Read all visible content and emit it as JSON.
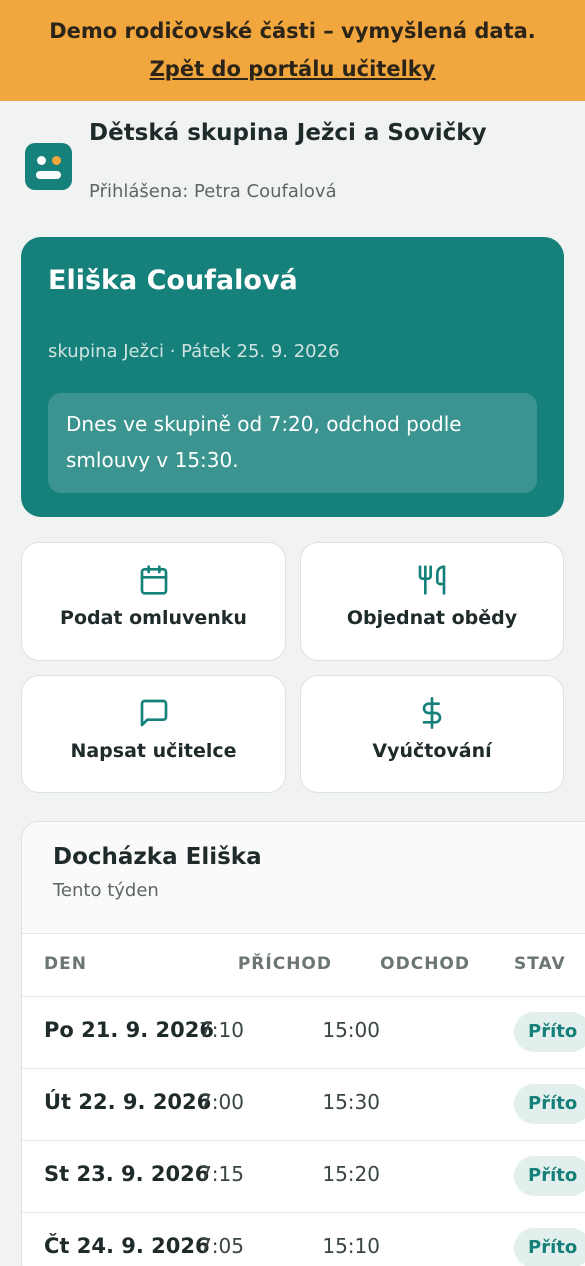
{
  "banner": {
    "text": "Demo rodičovské části – vymyšlená data.",
    "link": "Zpět do portálu učitelky"
  },
  "header": {
    "org_name": "Dětská skupina Ježci a Sovičky",
    "logged_in": "Přihlášena: Petra Coufalová"
  },
  "child": {
    "name": "Eliška Coufalová",
    "subtitle": "skupina Ježci · Pátek 25. 9. 2026",
    "note": "Dnes ve skupině od 7:20, odchod podle smlouvy v 15:30."
  },
  "actions": [
    {
      "label": "Podat omluvenku",
      "icon": "calendar-icon"
    },
    {
      "label": "Objednat obědy",
      "icon": "utensils-icon"
    },
    {
      "label": "Napsat učitelce",
      "icon": "message-icon"
    },
    {
      "label": "Vyúčtování",
      "icon": "dollar-icon"
    }
  ],
  "attendance": {
    "title": "Docházka Eliška",
    "subtitle": "Tento týden",
    "columns": [
      "DEN",
      "PŘÍCHOD",
      "ODCHOD",
      "STAV"
    ],
    "rows": [
      {
        "day": "Po 21. 9. 2026",
        "in": "7:10",
        "out": "15:00",
        "status": "Příto"
      },
      {
        "day": "Út 22. 9. 2026",
        "in": "7:00",
        "out": "15:30",
        "status": "Příto"
      },
      {
        "day": "St 23. 9. 2026",
        "in": "7:15",
        "out": "15:20",
        "status": "Příto"
      },
      {
        "day": "Čt 24. 9. 2026",
        "in": "7:05",
        "out": "15:10",
        "status": "Příto"
      }
    ]
  },
  "colors": {
    "accent": "#16807a",
    "banner": "#f2a63e",
    "background": "#f1f3f2"
  }
}
